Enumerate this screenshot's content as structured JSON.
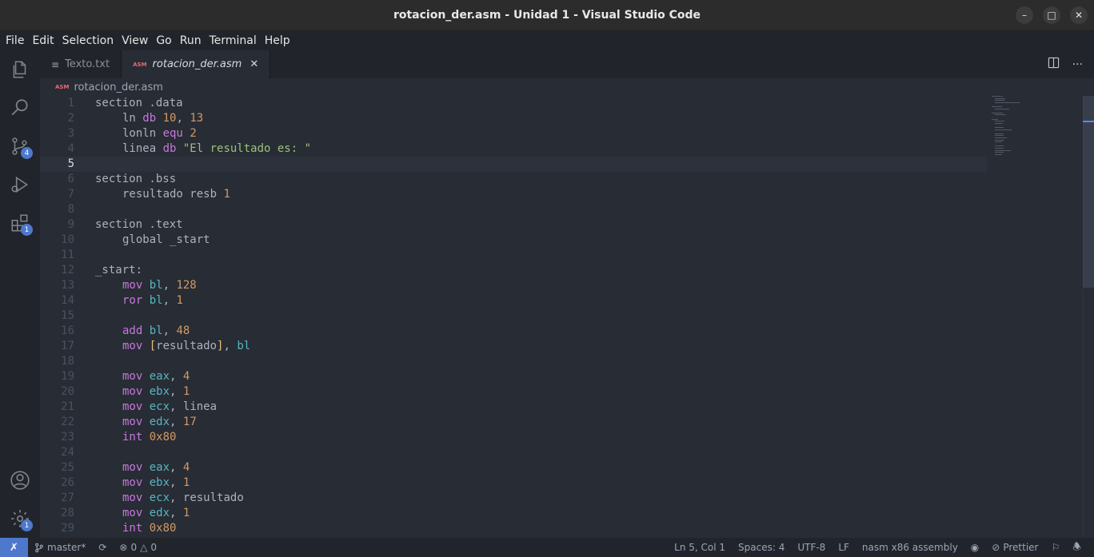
{
  "window": {
    "title": "rotacion_der.asm - Unidad 1 - Visual Studio Code"
  },
  "menu": [
    "File",
    "Edit",
    "Selection",
    "View",
    "Go",
    "Run",
    "Terminal",
    "Help"
  ],
  "activity": {
    "source_control_badge": "4",
    "extensions_badge": "1",
    "settings_badge": "1"
  },
  "tabs": [
    {
      "label": "Texto.txt",
      "active": false
    },
    {
      "label": "rotacion_der.asm",
      "active": true,
      "icon_text": "ASM"
    }
  ],
  "breadcrumb": {
    "icon_text": "ASM",
    "file": "rotacion_der.asm"
  },
  "editor": {
    "current_line": 5,
    "lines": [
      {
        "n": "1",
        "indent": 0,
        "tokens": [
          [
            "plain",
            "section .data"
          ]
        ]
      },
      {
        "n": "2",
        "indent": 1,
        "tokens": [
          [
            "plain",
            "ln "
          ],
          [
            "kw",
            "db"
          ],
          [
            "plain",
            " "
          ],
          [
            "num",
            "10"
          ],
          [
            "plain",
            ", "
          ],
          [
            "num",
            "13"
          ]
        ]
      },
      {
        "n": "3",
        "indent": 1,
        "tokens": [
          [
            "plain",
            "lonln "
          ],
          [
            "kw",
            "equ"
          ],
          [
            "plain",
            " "
          ],
          [
            "num",
            "2"
          ]
        ]
      },
      {
        "n": "4",
        "indent": 1,
        "tokens": [
          [
            "plain",
            "linea "
          ],
          [
            "kw",
            "db"
          ],
          [
            "plain",
            " "
          ],
          [
            "str",
            "\"El resultado es: \""
          ]
        ]
      },
      {
        "n": "5",
        "indent": 0,
        "tokens": []
      },
      {
        "n": "6",
        "indent": 0,
        "tokens": [
          [
            "plain",
            "section .bss"
          ]
        ]
      },
      {
        "n": "7",
        "indent": 1,
        "tokens": [
          [
            "plain",
            "resultado resb "
          ],
          [
            "num",
            "1"
          ]
        ]
      },
      {
        "n": "8",
        "indent": 0,
        "tokens": []
      },
      {
        "n": "9",
        "indent": 0,
        "tokens": [
          [
            "plain",
            "section .text"
          ]
        ]
      },
      {
        "n": "10",
        "indent": 1,
        "tokens": [
          [
            "plain",
            "global _start"
          ]
        ]
      },
      {
        "n": "11",
        "indent": 0,
        "tokens": []
      },
      {
        "n": "12",
        "indent": 0,
        "tokens": [
          [
            "plain",
            "_start:"
          ]
        ]
      },
      {
        "n": "13",
        "indent": 1,
        "tokens": [
          [
            "kw",
            "mov"
          ],
          [
            "plain",
            " "
          ],
          [
            "reg",
            "bl"
          ],
          [
            "plain",
            ", "
          ],
          [
            "num",
            "128"
          ]
        ]
      },
      {
        "n": "14",
        "indent": 1,
        "tokens": [
          [
            "kw",
            "ror"
          ],
          [
            "plain",
            " "
          ],
          [
            "reg",
            "bl"
          ],
          [
            "plain",
            ", "
          ],
          [
            "num",
            "1"
          ]
        ]
      },
      {
        "n": "15",
        "indent": 0,
        "tokens": []
      },
      {
        "n": "16",
        "indent": 1,
        "tokens": [
          [
            "kw",
            "add"
          ],
          [
            "plain",
            " "
          ],
          [
            "reg",
            "bl"
          ],
          [
            "plain",
            ", "
          ],
          [
            "num",
            "48"
          ]
        ]
      },
      {
        "n": "17",
        "indent": 1,
        "tokens": [
          [
            "kw",
            "mov"
          ],
          [
            "plain",
            " "
          ],
          [
            "br",
            "["
          ],
          [
            "plain",
            "resultado"
          ],
          [
            "br",
            "]"
          ],
          [
            "plain",
            ", "
          ],
          [
            "reg",
            "bl"
          ]
        ]
      },
      {
        "n": "18",
        "indent": 0,
        "tokens": []
      },
      {
        "n": "19",
        "indent": 1,
        "tokens": [
          [
            "kw",
            "mov"
          ],
          [
            "plain",
            " "
          ],
          [
            "reg",
            "eax"
          ],
          [
            "plain",
            ", "
          ],
          [
            "num",
            "4"
          ]
        ]
      },
      {
        "n": "20",
        "indent": 1,
        "tokens": [
          [
            "kw",
            "mov"
          ],
          [
            "plain",
            " "
          ],
          [
            "reg",
            "ebx"
          ],
          [
            "plain",
            ", "
          ],
          [
            "num",
            "1"
          ]
        ]
      },
      {
        "n": "21",
        "indent": 1,
        "tokens": [
          [
            "kw",
            "mov"
          ],
          [
            "plain",
            " "
          ],
          [
            "reg",
            "ecx"
          ],
          [
            "plain",
            ", linea"
          ]
        ]
      },
      {
        "n": "22",
        "indent": 1,
        "tokens": [
          [
            "kw",
            "mov"
          ],
          [
            "plain",
            " "
          ],
          [
            "reg",
            "edx"
          ],
          [
            "plain",
            ", "
          ],
          [
            "num",
            "17"
          ]
        ]
      },
      {
        "n": "23",
        "indent": 1,
        "tokens": [
          [
            "kw",
            "int"
          ],
          [
            "plain",
            " "
          ],
          [
            "num",
            "0x80"
          ]
        ]
      },
      {
        "n": "24",
        "indent": 0,
        "tokens": []
      },
      {
        "n": "25",
        "indent": 1,
        "tokens": [
          [
            "kw",
            "mov"
          ],
          [
            "plain",
            " "
          ],
          [
            "reg",
            "eax"
          ],
          [
            "plain",
            ", "
          ],
          [
            "num",
            "4"
          ]
        ]
      },
      {
        "n": "26",
        "indent": 1,
        "tokens": [
          [
            "kw",
            "mov"
          ],
          [
            "plain",
            " "
          ],
          [
            "reg",
            "ebx"
          ],
          [
            "plain",
            ", "
          ],
          [
            "num",
            "1"
          ]
        ]
      },
      {
        "n": "27",
        "indent": 1,
        "tokens": [
          [
            "kw",
            "mov"
          ],
          [
            "plain",
            " "
          ],
          [
            "reg",
            "ecx"
          ],
          [
            "plain",
            ", resultado"
          ]
        ]
      },
      {
        "n": "28",
        "indent": 1,
        "tokens": [
          [
            "kw",
            "mov"
          ],
          [
            "plain",
            " "
          ],
          [
            "reg",
            "edx"
          ],
          [
            "plain",
            ", "
          ],
          [
            "num",
            "1"
          ]
        ]
      },
      {
        "n": "29",
        "indent": 1,
        "tokens": [
          [
            "kw",
            "int"
          ],
          [
            "plain",
            " "
          ],
          [
            "num",
            "0x80"
          ]
        ]
      }
    ]
  },
  "status": {
    "branch": "master*",
    "errors": "0",
    "warnings": "0",
    "position": "Ln 5, Col 1",
    "spaces": "Spaces: 4",
    "encoding": "UTF-8",
    "eol": "LF",
    "language": "nasm x86 assembly",
    "prettier": "Prettier"
  },
  "colors": {
    "accent": "#4d78cc",
    "keyword": "#c678dd",
    "register": "#56b6c2",
    "number": "#d19a66",
    "string": "#98c379"
  }
}
